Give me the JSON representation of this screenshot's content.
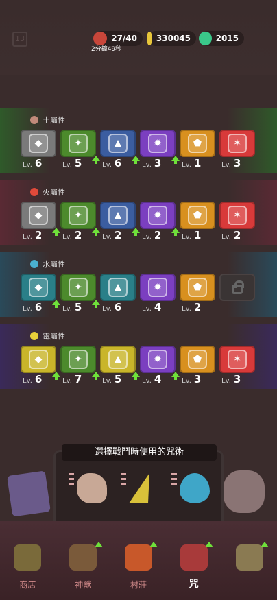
{
  "hud": {
    "level": "13",
    "energy": "27/40",
    "timer": "2分鐘49秒",
    "gold": "330045",
    "gems": "2015"
  },
  "sections": [
    {
      "title": "土屬性",
      "cards": [
        {
          "color": "gray",
          "lv_prefix": "Lv.",
          "level": "6",
          "upgrade": false
        },
        {
          "color": "green",
          "lv_prefix": "Lv.",
          "level": "5",
          "upgrade": true
        },
        {
          "color": "blue",
          "lv_prefix": "Lv.",
          "level": "6",
          "upgrade": true
        },
        {
          "color": "purple",
          "lv_prefix": "Lv.",
          "level": "3",
          "upgrade": true
        },
        {
          "color": "orange",
          "lv_prefix": "Lv.",
          "level": "1",
          "upgrade": false
        },
        {
          "color": "red",
          "lv_prefix": "Lv.",
          "level": "3",
          "upgrade": false
        }
      ]
    },
    {
      "title": "火屬性",
      "cards": [
        {
          "color": "gray",
          "lv_prefix": "Lv.",
          "level": "2",
          "upgrade": true
        },
        {
          "color": "green",
          "lv_prefix": "Lv.",
          "level": "2",
          "upgrade": true
        },
        {
          "color": "blue",
          "lv_prefix": "Lv.",
          "level": "2",
          "upgrade": true
        },
        {
          "color": "purple",
          "lv_prefix": "Lv.",
          "level": "2",
          "upgrade": true
        },
        {
          "color": "orange",
          "lv_prefix": "Lv.",
          "level": "1",
          "upgrade": false
        },
        {
          "color": "red",
          "lv_prefix": "Lv.",
          "level": "2",
          "upgrade": false
        }
      ]
    },
    {
      "title": "水屬性",
      "cards": [
        {
          "color": "teal",
          "lv_prefix": "Lv.",
          "level": "6",
          "upgrade": true
        },
        {
          "color": "green",
          "lv_prefix": "Lv.",
          "level": "5",
          "upgrade": true
        },
        {
          "color": "teal",
          "lv_prefix": "Lv.",
          "level": "6",
          "upgrade": false
        },
        {
          "color": "purple",
          "lv_prefix": "Lv.",
          "level": "4",
          "upgrade": false
        },
        {
          "color": "orange",
          "lv_prefix": "Lv.",
          "level": "2",
          "upgrade": false
        },
        {
          "color": "locked",
          "lv_prefix": "",
          "level": "",
          "upgrade": false
        }
      ]
    },
    {
      "title": "電屬性",
      "cards": [
        {
          "color": "yellow",
          "lv_prefix": "Lv.",
          "level": "6",
          "upgrade": true
        },
        {
          "color": "green",
          "lv_prefix": "Lv.",
          "level": "7",
          "upgrade": true
        },
        {
          "color": "yellow",
          "lv_prefix": "Lv.",
          "level": "5",
          "upgrade": true
        },
        {
          "color": "purple",
          "lv_prefix": "Lv.",
          "level": "4",
          "upgrade": true
        },
        {
          "color": "orange",
          "lv_prefix": "Lv.",
          "level": "3",
          "upgrade": false
        },
        {
          "color": "red",
          "lv_prefix": "Lv.",
          "level": "3",
          "upgrade": false
        }
      ]
    }
  ],
  "section_colors": [
    "#2f5a2a",
    "#5a2a34",
    "#2a4a5a",
    "#3a2a5a"
  ],
  "spell_panel": {
    "title": "選擇戰鬥時使用的咒術",
    "spells": [
      "rock-spell-icon",
      "lightning-spell-icon",
      "water-spell-icon"
    ]
  },
  "nav": {
    "items": [
      {
        "label": "商店",
        "icon": "shop-icon",
        "upgrade": false
      },
      {
        "label": "神獸",
        "icon": "beast-icon",
        "upgrade": true
      },
      {
        "label": "村莊",
        "icon": "village-icon",
        "upgrade": true
      },
      {
        "label": "咒",
        "icon": "spell-icon",
        "upgrade": true
      },
      {
        "label": "",
        "icon": "map-icon",
        "upgrade": true
      }
    ],
    "active_index": 3
  }
}
